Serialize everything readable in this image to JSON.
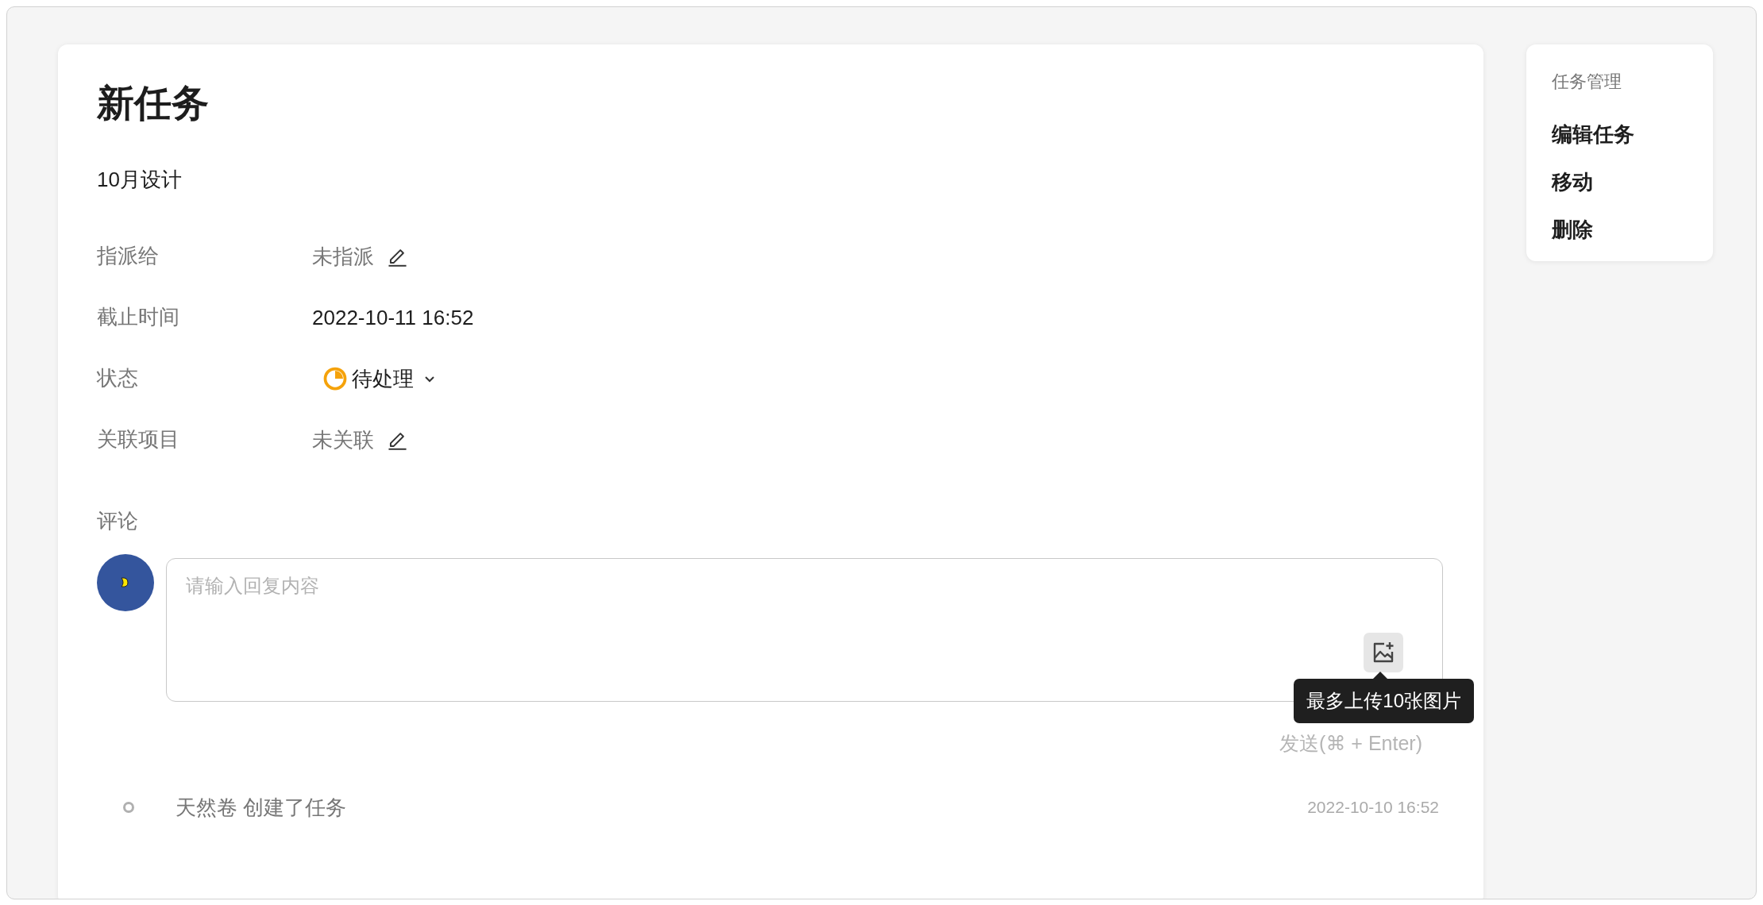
{
  "task": {
    "title": "新任务",
    "project": "10月设计",
    "fields": [
      {
        "label": "指派给",
        "value": "未指派",
        "kind": "editable"
      },
      {
        "label": "截止时间",
        "value": "2022-10-11 16:52",
        "kind": "plain"
      },
      {
        "label": "状态",
        "value": "待处理",
        "kind": "status"
      },
      {
        "label": "关联项目",
        "value": "未关联",
        "kind": "editable"
      }
    ]
  },
  "comments": {
    "heading": "评论",
    "placeholder": "请输入回复内容",
    "tooltip": "最多上传10张图片",
    "send_hint": "发送(⌘ + Enter)"
  },
  "activity": [
    {
      "text": "天然卷 创建了任务",
      "time": "2022-10-10 16:52"
    }
  ],
  "menu": {
    "heading": "任务管理",
    "items": [
      "编辑任务",
      "移动",
      "删除"
    ]
  }
}
